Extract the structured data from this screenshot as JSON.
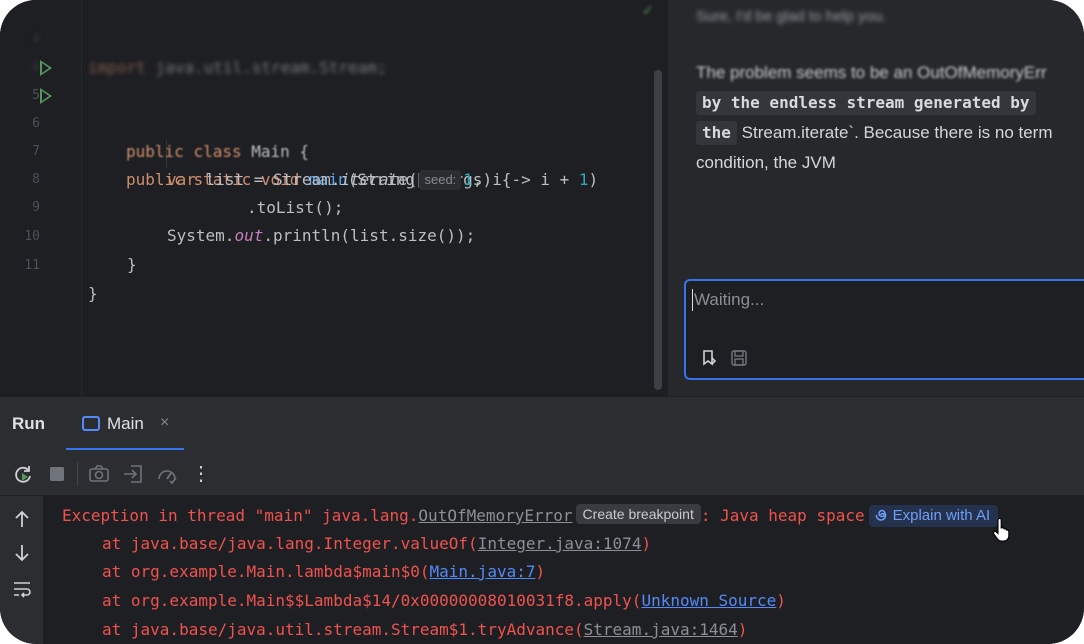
{
  "editor": {
    "lines": [
      {
        "num": "4",
        "blurred": true,
        "import_kw": "import",
        "import_path": "java.util.stream.Stream;"
      },
      {
        "num": "6"
      },
      {
        "num": "5",
        "tokens": {
          "kw1": "public",
          "kw2": "class",
          "name": "Main {"
        }
      },
      {
        "num": "6",
        "tokens": {
          "kw1": "public",
          "kw2": "static",
          "kw3": "void",
          "fn": "main",
          "rest": "(String[] args) {"
        }
      },
      {
        "num": "7",
        "tokens": {
          "kw": "var",
          "a": "list = Stream.",
          "fn": "iterate",
          "b": "(",
          "hint": "seed:",
          "num": "1",
          "c": ", i -> i + ",
          "num2": "1",
          "d": ")"
        }
      },
      {
        "num": "8",
        "tokens": {
          "a": ".toList();"
        }
      },
      {
        "num": "9",
        "tokens": {
          "a": "System.",
          "fld": "out",
          "b": ".println(list.size());"
        }
      },
      {
        "num": "10",
        "tokens": {
          "a": "}"
        }
      },
      {
        "num": "11",
        "tokens": {
          "a": "}"
        }
      }
    ]
  },
  "chat": {
    "greeting": "Sure, I'd be glad to help you.",
    "line1": "The problem seems to be an OutOfMemoryErr",
    "code1": "by the endless stream generated by",
    "code2": "the",
    "text2": "Stream.iterate`. Because there is no term",
    "text3": "condition, the JVM",
    "input_placeholder": "Waiting...",
    "icons": [
      "bookmark-icon",
      "save-icon"
    ]
  },
  "run": {
    "title": "Run",
    "tab_label": "Main",
    "tab_close": "×",
    "more_glyph": "⋮"
  },
  "console": {
    "exception_prefix": "Exception in thread \"main\" java.lang.",
    "exception_class": "OutOfMemoryError",
    "create_breakpoint": "Create breakpoint",
    "exception_suffix": ": Java heap space",
    "explain_ai": "Explain with AI",
    "frames": [
      {
        "text": "at java.base/java.lang.Integer.valueOf(",
        "link": "Integer.java:1074",
        "end": ")",
        "active": false
      },
      {
        "text": "at org.example.Main.lambda$main$0(",
        "link": "Main.java:7",
        "end": ")",
        "active": true
      },
      {
        "text": "at org.example.Main$$Lambda$14/0x00000008010031f8.apply(",
        "link": "Unknown Source",
        "end": ")",
        "active": true
      },
      {
        "text": "at java.base/java.util.stream.Stream$1.tryAdvance(",
        "link": "Stream.java:1464",
        "end": ")",
        "active": false
      }
    ]
  },
  "colors": {
    "accent": "#3574f0",
    "error": "#f0524f",
    "run_green": "#57965c"
  }
}
